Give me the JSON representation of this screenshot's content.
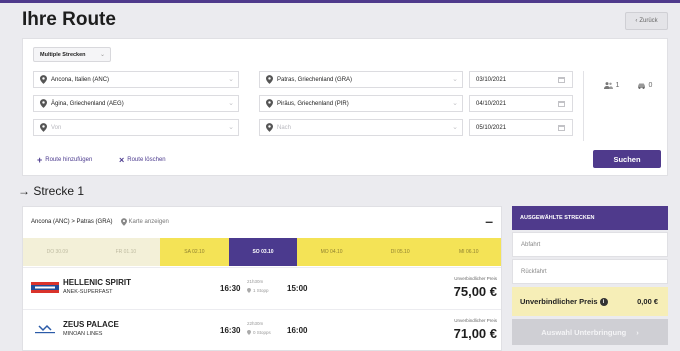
{
  "page": {
    "title": "Ihre Route",
    "back_label": "Zurück"
  },
  "search": {
    "mode": "Multiple Strecken",
    "legs": [
      {
        "from": "Ancona, Italien (ANC)",
        "to": "Patras, Griechenland (GRA)",
        "date": "03/10/2021"
      },
      {
        "from": "Ägina, Griechenland (AEG)",
        "to": "Piräus, Griechenland (PIR)",
        "date": "04/10/2021"
      },
      {
        "from_placeholder": "Von",
        "to_placeholder": "Nach",
        "date": "05/10/2021"
      }
    ],
    "passengers": "1",
    "vehicles": "0",
    "add_route": "Route hinzufügen",
    "delete_route": "Route löschen",
    "search_button": "Suchen"
  },
  "leg_section": {
    "title": "→ Strecke 1",
    "route_label": "Ancona (ANC) > Patras (GRA)",
    "map_link": "Karte anzeigen",
    "dates": [
      {
        "label": "DO 30.09",
        "state": "past"
      },
      {
        "label": "FR 01.10",
        "state": "past"
      },
      {
        "label": "SA 02.10",
        "state": "avail"
      },
      {
        "label": "SO 03.10",
        "state": "sel"
      },
      {
        "label": "MO 04.10",
        "state": "avail"
      },
      {
        "label": "DI 05.10",
        "state": "avail"
      },
      {
        "label": "MI 06.10",
        "state": "avail"
      }
    ],
    "sailings": [
      {
        "ship": "HELLENIC SPIRIT",
        "company": "ANEK-SUPERFAST",
        "departure": "16:30",
        "duration": "21h30m",
        "stops": "1 Stopp",
        "arrival": "15:00",
        "price_label": "Unverbindlicher Preis",
        "price": "75,00 €"
      },
      {
        "ship": "ZEUS PALACE",
        "company": "MINOAN LINES",
        "departure": "16:30",
        "duration": "22h30m",
        "stops": "0 Stopps",
        "arrival": "16:00",
        "price_label": "Unverbindlicher Preis",
        "price": "71,00 €"
      }
    ]
  },
  "summary": {
    "header": "AUSGEWÄHLTE STRECKEN",
    "departure": "Abfahrt",
    "return": "Rückfahrt",
    "price_label": "Unverbindlicher Preis",
    "price_value": "0,00 €",
    "accommodation_button": "Auswahl Unterbringung"
  },
  "colors": {
    "brand": "#4f3a8c",
    "date_available": "#f4e356",
    "price_highlight": "#f6eeb7"
  }
}
